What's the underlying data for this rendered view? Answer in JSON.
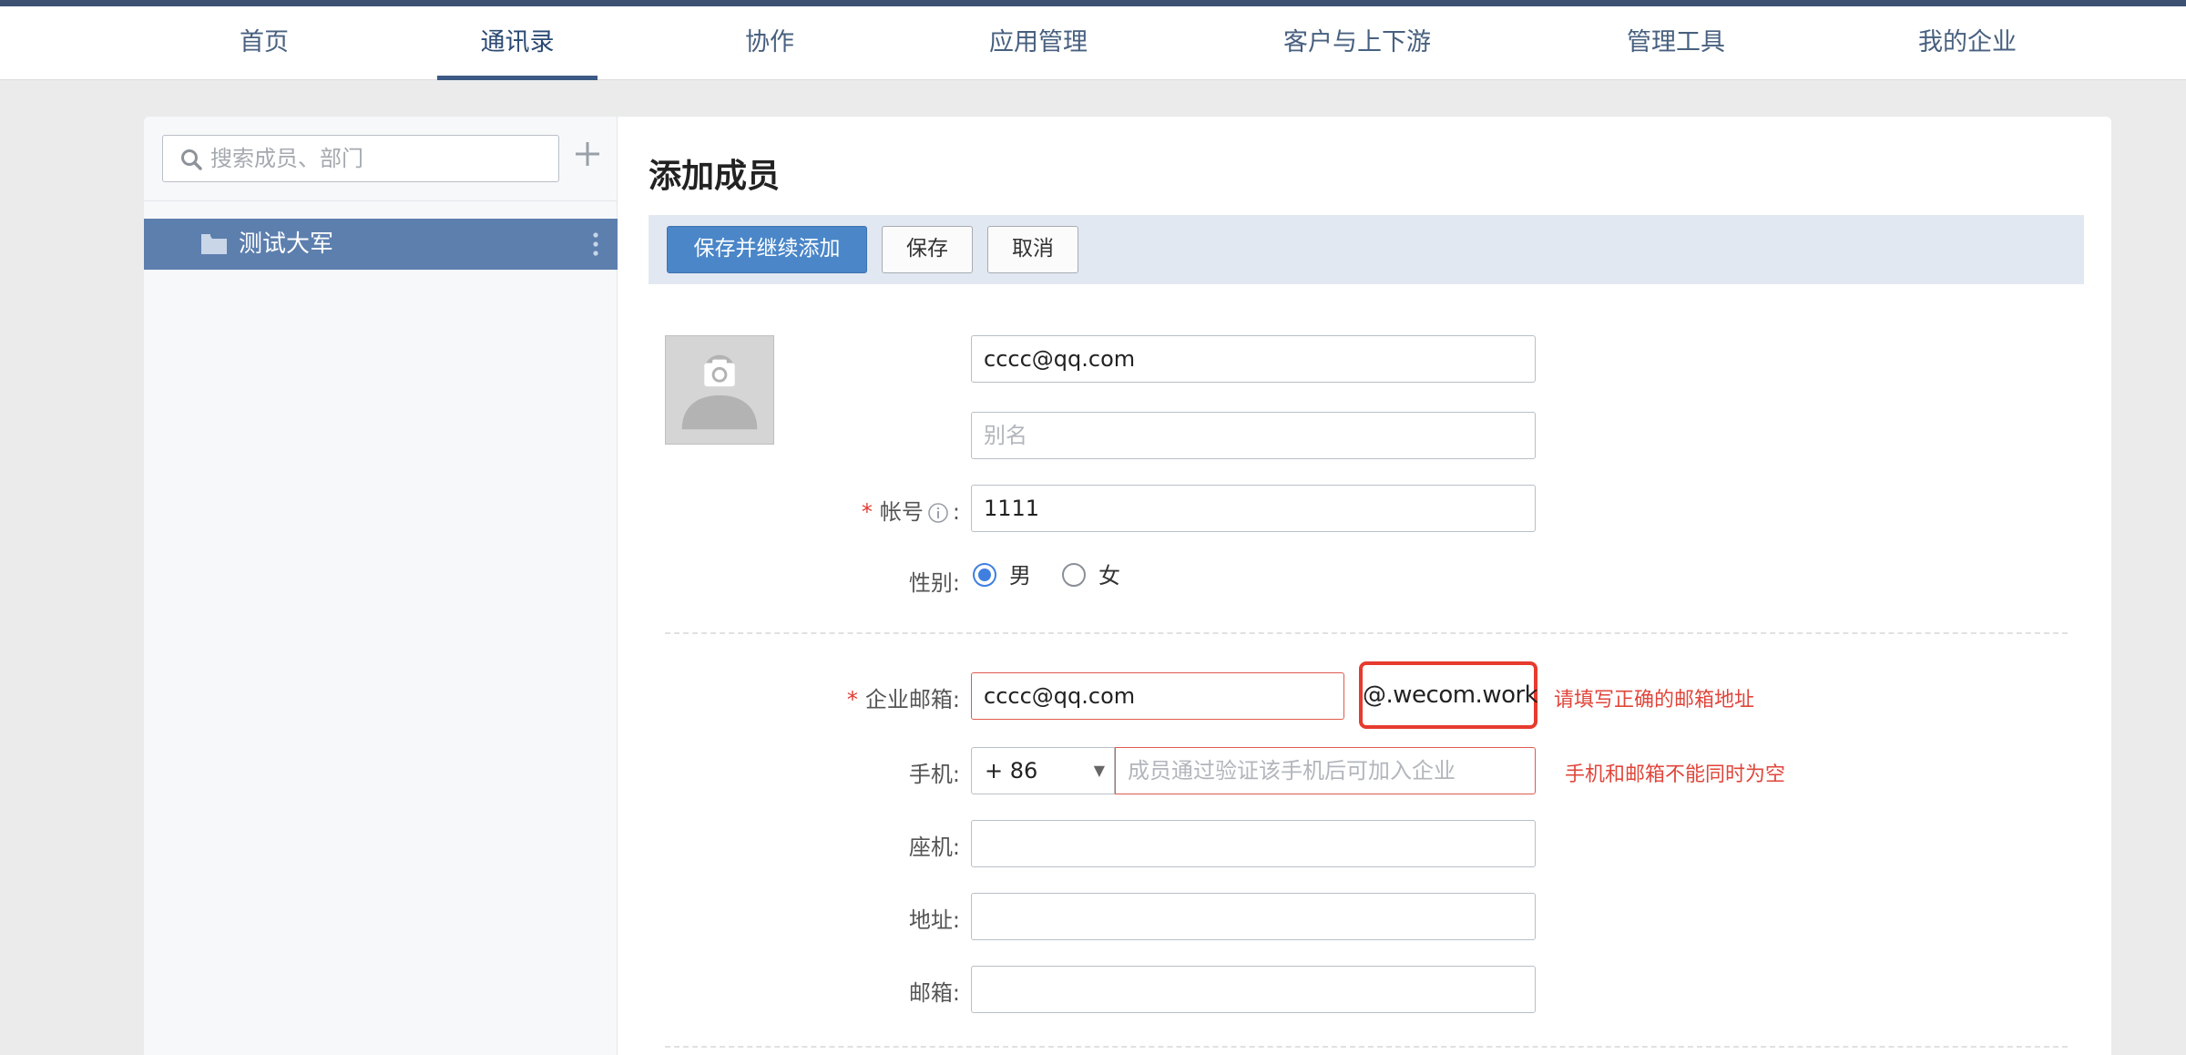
{
  "nav": {
    "items": [
      {
        "label": "首页"
      },
      {
        "label": "通讯录"
      },
      {
        "label": "协作"
      },
      {
        "label": "应用管理"
      },
      {
        "label": "客户与上下游"
      },
      {
        "label": "管理工具"
      },
      {
        "label": "我的企业"
      }
    ],
    "active_index": 1
  },
  "sidebar": {
    "search_placeholder": "搜索成员、部门",
    "departments": [
      {
        "label": "测试大军",
        "selected": true
      }
    ]
  },
  "main": {
    "title": "添加成员",
    "toolbar": {
      "save_continue_label": "保存并继续添加",
      "save_label": "保存",
      "cancel_label": "取消"
    },
    "form": {
      "name_value": "cccc@qq.com",
      "alias_placeholder": "别名",
      "account_label": "帐号",
      "account_value": "1111",
      "gender_label": "性别:",
      "gender_options": [
        {
          "label": "男",
          "checked": true
        },
        {
          "label": "女",
          "checked": false
        }
      ],
      "corp_email_label": "企业邮箱:",
      "corp_email_value": "cccc@qq.com",
      "corp_email_domain": "@.wecom.work",
      "corp_email_error": "请填写正确的邮箱地址",
      "mobile_label": "手机:",
      "mobile_country_code": "+ 86",
      "mobile_placeholder": "成员通过验证该手机后可加入企业",
      "mobile_error": "手机和邮箱不能同时为空",
      "landline_label": "座机:",
      "address_label": "地址:",
      "email_label": "邮箱:"
    }
  },
  "colors": {
    "nav_text": "#48607f",
    "primary": "#4a86c8",
    "selected_dept": "#5d7fae",
    "error": "#e0463b",
    "highlight_border": "#e63b2e"
  }
}
